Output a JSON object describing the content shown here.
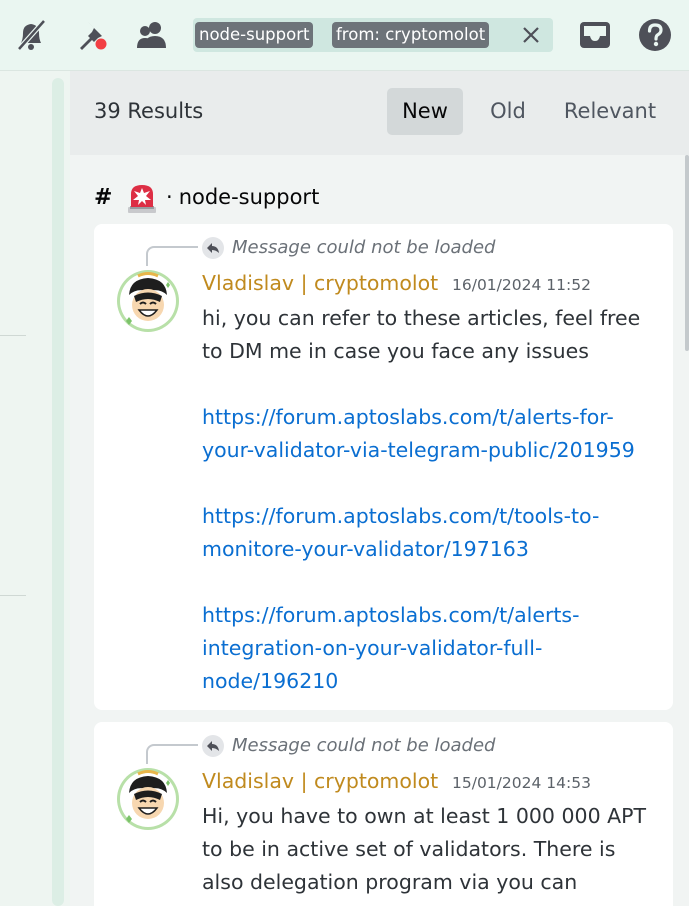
{
  "toolbar": {
    "icons": [
      "bell-slash-icon",
      "pin-icon",
      "members-icon",
      "inbox-icon",
      "help-icon"
    ],
    "search_chips": [
      "node-support",
      "from: cryptomolot"
    ],
    "clear_icon": "close-icon"
  },
  "results": {
    "count_label": "39 Results",
    "sort_tabs": [
      "New",
      "Old",
      "Relevant"
    ],
    "active_sort": "New"
  },
  "channel": {
    "hash": "#",
    "emoji": "siren-icon",
    "separator": "·",
    "name": "node-support"
  },
  "messages": [
    {
      "reply_note": "Message could not be loaded",
      "author": "Vladislav | cryptomolot",
      "timestamp": "16/01/2024 11:52",
      "text": "hi, you can refer to these articles, feel free to DM me in case you face any issues",
      "links": [
        "https://forum.aptoslabs.com/t/alerts-for-your-validator-via-telegram-public/201959",
        "https://forum.aptoslabs.com/t/tools-to-monitore-your-validator/197163",
        "https://forum.aptoslabs.com/t/alerts-integration-on-your-validator-full-node/196210"
      ]
    },
    {
      "reply_note": "Message could not be loaded",
      "author": "Vladislav | cryptomolot",
      "timestamp": "15/01/2024 14:53",
      "text": "Hi, you have to own at least 1 000 000 APT to be in active set of validators. There is also delegation program via you can"
    }
  ],
  "colors": {
    "author": "#c08a1e",
    "link": "#0a6ed1",
    "chip_bg": "#6d7379",
    "active_tab_bg": "#d3d8d9"
  }
}
